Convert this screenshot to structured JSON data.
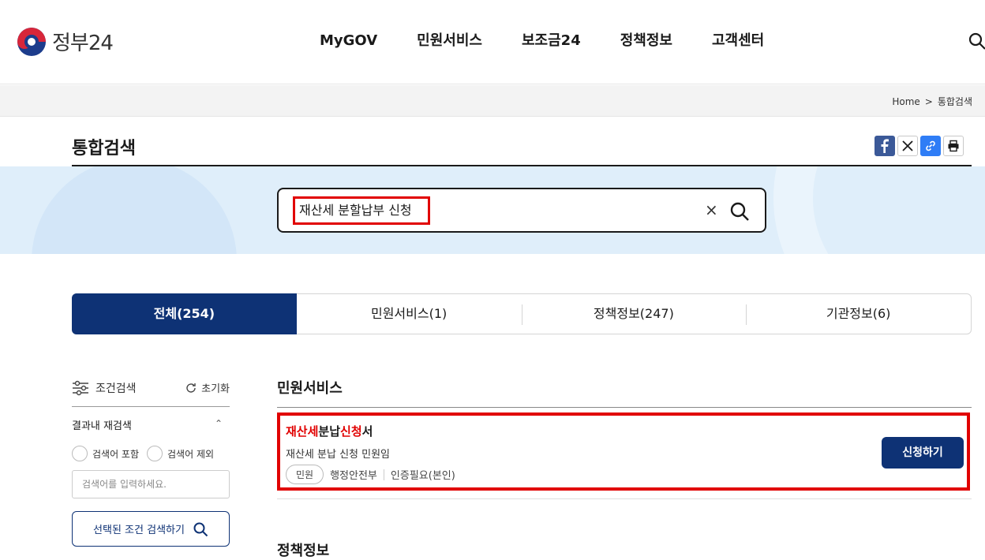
{
  "header": {
    "logo_text": "정부24",
    "nav": [
      "MyGOV",
      "민원서비스",
      "보조금24",
      "정책정보",
      "고객센터"
    ]
  },
  "breadcrumb": {
    "home": "Home",
    "separator": ">",
    "current": "통합검색"
  },
  "page": {
    "title": "통합검색"
  },
  "share": {
    "icons": [
      "facebook-icon",
      "x-icon",
      "link-icon",
      "print-icon"
    ]
  },
  "search": {
    "query": "재산세 분할납부 신청",
    "clear": "×"
  },
  "tabs": [
    {
      "label": "전체(254)",
      "active": true
    },
    {
      "label": "민원서비스(1)",
      "active": false
    },
    {
      "label": "정책정보(247)",
      "active": false
    },
    {
      "label": "기관정보(6)",
      "active": false
    }
  ],
  "filter": {
    "title": "조건검색",
    "reset": "초기화",
    "refine_title": "결과내 재검색",
    "include": "검색어 포함",
    "exclude": "검색어 제외",
    "placeholder": "검색어를 입력하세요.",
    "apply": "선택된 조건 검색하기"
  },
  "results": {
    "section_title": "민원서비스",
    "item": {
      "title_parts": [
        {
          "text": "재산세",
          "highlight": true
        },
        {
          "text": "분납",
          "highlight": false
        },
        {
          "text": "신청",
          "highlight": true
        },
        {
          "text": "서",
          "highlight": false
        }
      ],
      "desc": "재산세 분납 신청 민원임",
      "badge": "민원",
      "agency": "행정안전부",
      "auth": "인증필요(본인)",
      "button": "신청하기"
    },
    "next_section_title": "정책정보"
  },
  "colors": {
    "primary": "#0e3275",
    "highlight": "#e10000",
    "banner": "#dfeefa"
  }
}
